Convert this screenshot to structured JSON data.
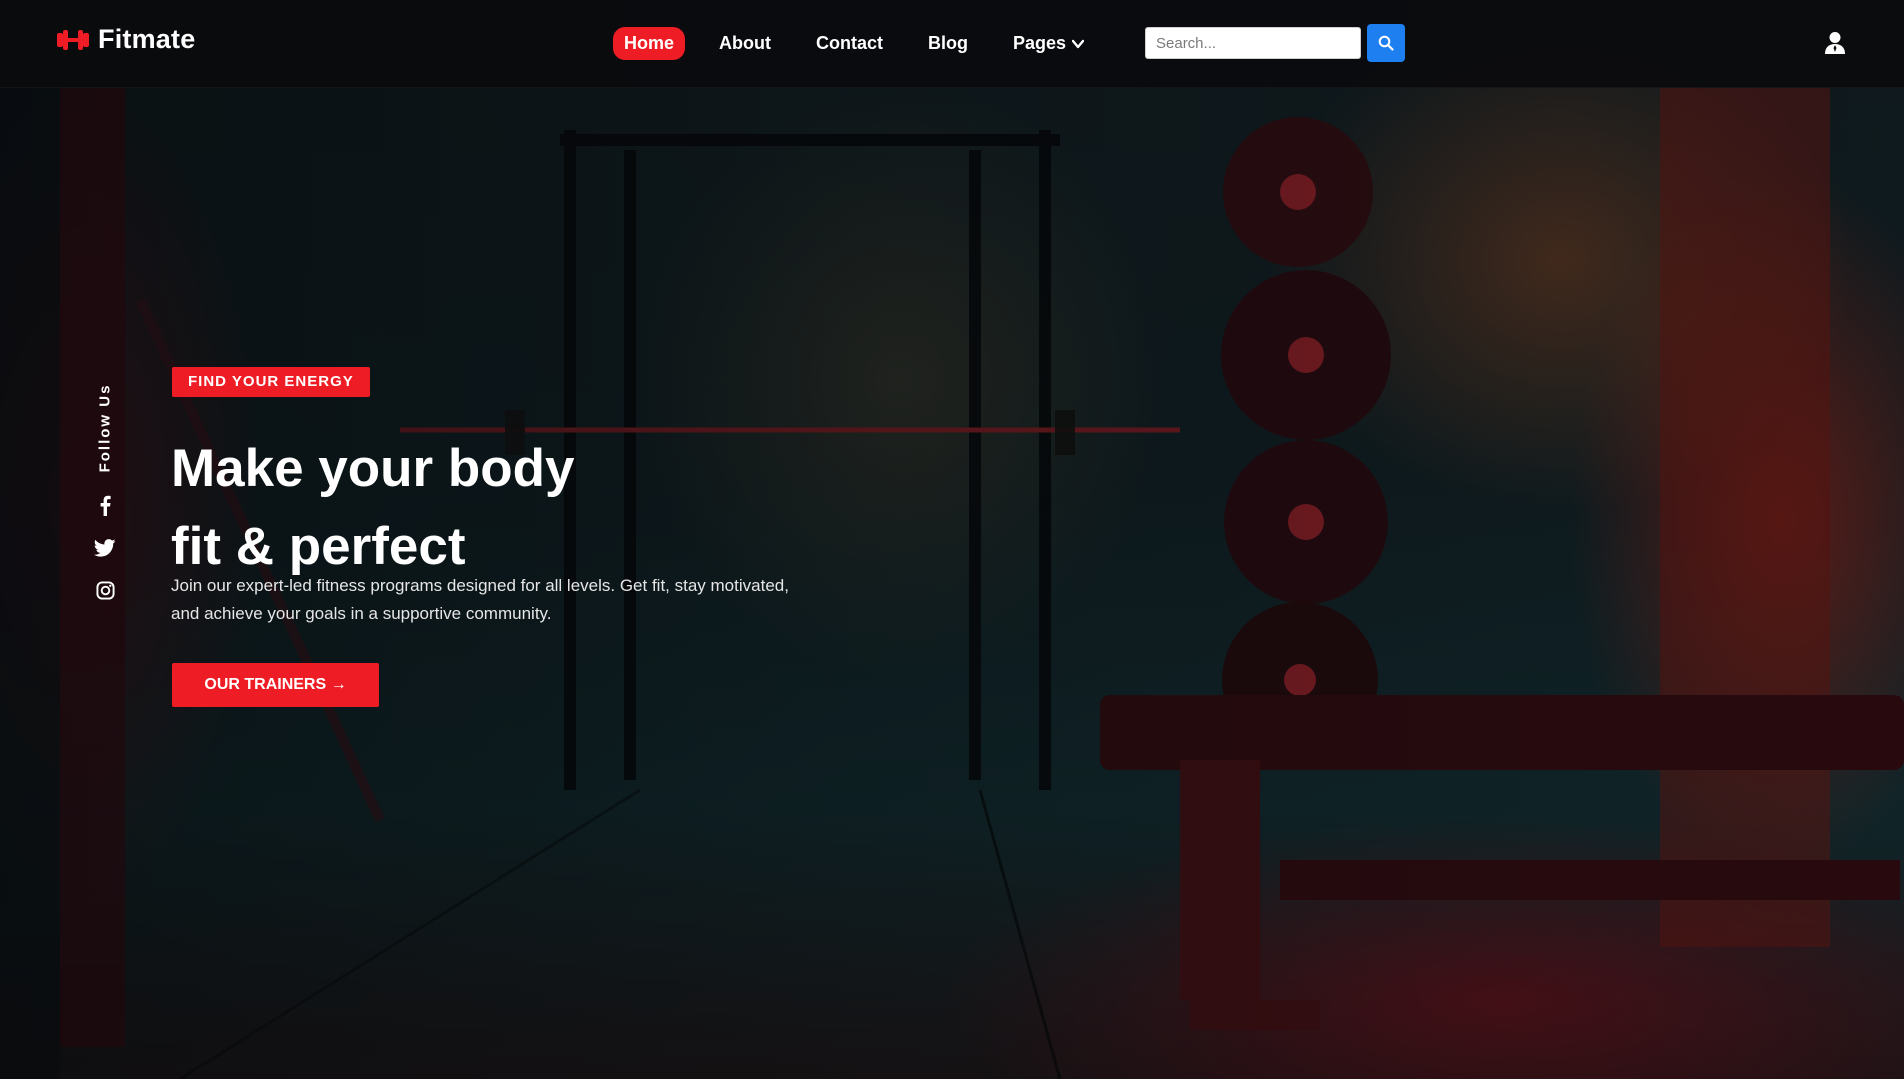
{
  "brand": {
    "name": "Fitmate",
    "icon": "dumbbell-icon",
    "accent_color": "#ee1c24"
  },
  "nav": {
    "items": [
      {
        "label": "Home",
        "active": true
      },
      {
        "label": "About",
        "active": false
      },
      {
        "label": "Contact",
        "active": false
      },
      {
        "label": "Blog",
        "active": false
      },
      {
        "label": "Pages",
        "active": false,
        "has_dropdown": true
      }
    ]
  },
  "search": {
    "placeholder": "Search...",
    "value": "",
    "button_icon": "search-icon",
    "button_color": "#1d7ff0"
  },
  "header": {
    "user_icon": "user-icon"
  },
  "social": {
    "label": "Follow Us",
    "icons": [
      "facebook-icon",
      "twitter-icon",
      "instagram-icon"
    ]
  },
  "hero": {
    "tagline": "FIND YOUR ENERGY",
    "headline_line1": "Make your body",
    "headline_line2": "fit & perfect",
    "description_line1": "Join our expert-led fitness programs designed for all levels. Get fit, stay motivated,",
    "description_line2": "and achieve your goals in a supportive community.",
    "cta_label": "OUR TRAINERS →"
  }
}
